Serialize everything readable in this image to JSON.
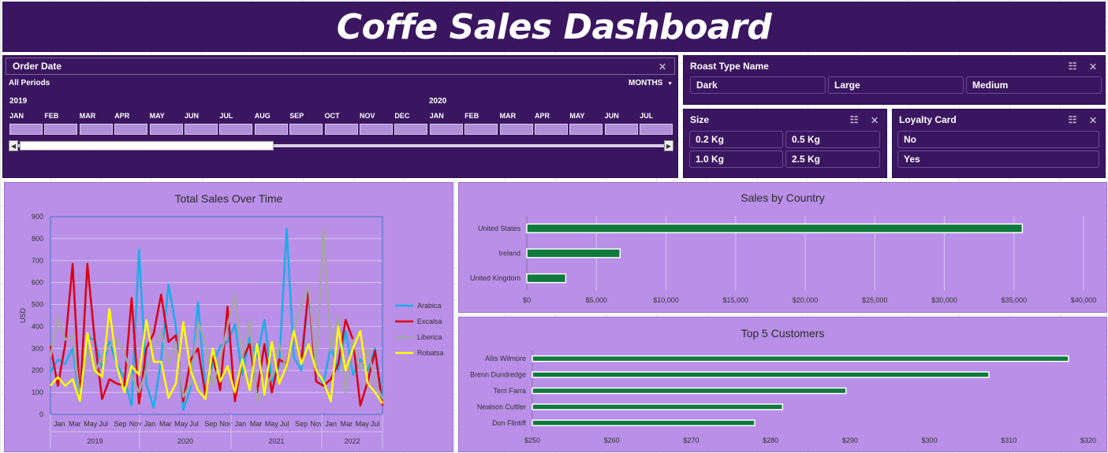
{
  "dashboard_title": "Coffe Sales Dashboard",
  "timeline": {
    "title": "Order Date",
    "periods_label": "All Periods",
    "level_label": "MONTHS",
    "years": [
      "2019",
      "2020"
    ],
    "months": [
      "JAN",
      "FEB",
      "MAR",
      "APR",
      "MAY",
      "JUN",
      "JUL",
      "AUG",
      "SEP",
      "OCT",
      "NOV",
      "DEC",
      "JAN",
      "FEB",
      "MAR",
      "APR",
      "MAY",
      "JUN",
      "JUL"
    ],
    "scroll_left": "◀",
    "scroll_right": "▶"
  },
  "slicer_icons": {
    "multi_select": "☷",
    "clear_filter": "⨯"
  },
  "roast_slicer": {
    "title": "Roast Type Name",
    "items": [
      "Dark",
      "Large",
      "Medium"
    ]
  },
  "size_slicer": {
    "title": "Size",
    "items": [
      "0.2 Kg",
      "0.5 Kg",
      "1.0 Kg",
      "2.5 Kg"
    ]
  },
  "loyalty_slicer": {
    "title": "Loyalty Card",
    "items": [
      "No",
      "Yes"
    ]
  },
  "colors": {
    "dark_purple": "#3b1660",
    "light_purple": "#b98fe7",
    "bar_green": "#0f7a3c"
  },
  "chart_data": [
    {
      "type": "line",
      "title": "Total Sales Over Time",
      "ylabel": "USD",
      "ylim": [
        0,
        900
      ],
      "yticks": [
        0,
        100,
        200,
        300,
        400,
        500,
        600,
        700,
        800,
        900
      ],
      "x_month_labels": [
        "Jan",
        "Mar",
        "May",
        "Jul",
        "Sep",
        "Nov",
        "Jan",
        "Mar",
        "May",
        "Jul",
        "Sep",
        "Nov",
        "Jan",
        "Mar",
        "May",
        "Jul",
        "Sep",
        "Nov",
        "Jan",
        "Mar",
        "May",
        "Jul"
      ],
      "x_year_labels": [
        "2019",
        "2020",
        "2021",
        "2022"
      ],
      "legend_position": "right",
      "series": [
        {
          "name": "Arabica",
          "color": "#19aee8",
          "values": [
            190,
            250,
            230,
            300,
            55,
            350,
            340,
            210,
            330,
            230,
            165,
            40,
            750,
            140,
            30,
            250,
            590,
            400,
            20,
            120,
            510,
            100,
            230,
            310,
            330,
            410,
            180,
            350,
            260,
            430,
            150,
            220,
            845,
            260,
            200,
            570,
            200,
            140,
            310,
            200,
            380,
            180,
            250,
            200,
            300,
            70
          ]
        },
        {
          "name": "Excalsa",
          "color": "#dc0011",
          "values": [
            310,
            130,
            320,
            685,
            65,
            685,
            340,
            70,
            160,
            140,
            130,
            530,
            50,
            300,
            370,
            545,
            330,
            360,
            60,
            250,
            300,
            90,
            270,
            110,
            490,
            60,
            250,
            320,
            100,
            320,
            100,
            250,
            230,
            375,
            240,
            570,
            150,
            130,
            160,
            230,
            430,
            340,
            40,
            150,
            290,
            40
          ]
        },
        {
          "name": "Liberica",
          "color": "#a6a6a6",
          "values": [
            260,
            440,
            340,
            360,
            80,
            300,
            180,
            270,
            310,
            340,
            280,
            180,
            100,
            200,
            300,
            380,
            230,
            330,
            80,
            140,
            420,
            330,
            130,
            250,
            400,
            550,
            250,
            430,
            60,
            100,
            180,
            320,
            200,
            380,
            500,
            580,
            200,
            845,
            290,
            450,
            100,
            340,
            200,
            300,
            150,
            70
          ]
        },
        {
          "name": "Robatsa",
          "color": "#ffff00",
          "values": [
            130,
            170,
            130,
            160,
            60,
            370,
            200,
            170,
            480,
            220,
            100,
            220,
            180,
            430,
            240,
            240,
            75,
            140,
            420,
            200,
            110,
            70,
            300,
            150,
            220,
            100,
            250,
            110,
            320,
            90,
            330,
            140,
            220,
            380,
            230,
            320,
            200,
            150,
            60,
            400,
            200,
            300,
            380,
            140,
            100,
            50
          ]
        }
      ]
    },
    {
      "type": "bar",
      "title": "Sales by Country",
      "categories": [
        "United States",
        "Ireland",
        "United Kingdom"
      ],
      "values": [
        35600,
        6700,
        2800
      ],
      "xlim": [
        0,
        40000
      ],
      "xticks": [
        0,
        5000,
        10000,
        15000,
        20000,
        25000,
        30000,
        35000,
        40000
      ],
      "xtick_labels": [
        "$0",
        "$5,000",
        "$10,000",
        "$15,000",
        "$20,000",
        "$25,000",
        "$30,000",
        "$35,000",
        "$40,000"
      ]
    },
    {
      "type": "bar",
      "title": "Top 5 Customers",
      "categories": [
        "Allis Wilmore",
        "Brenn Dundredge",
        "Terri Farra",
        "Nealson Cuttler",
        "Don Flintiff"
      ],
      "values": [
        317.5,
        307.5,
        289.5,
        281.5,
        278.0
      ],
      "xlim": [
        250,
        320
      ],
      "xticks": [
        250,
        260,
        270,
        280,
        290,
        300,
        310,
        320
      ],
      "xtick_labels": [
        "$250",
        "$260",
        "$270",
        "$280",
        "$290",
        "$300",
        "$310",
        "$320"
      ]
    }
  ]
}
